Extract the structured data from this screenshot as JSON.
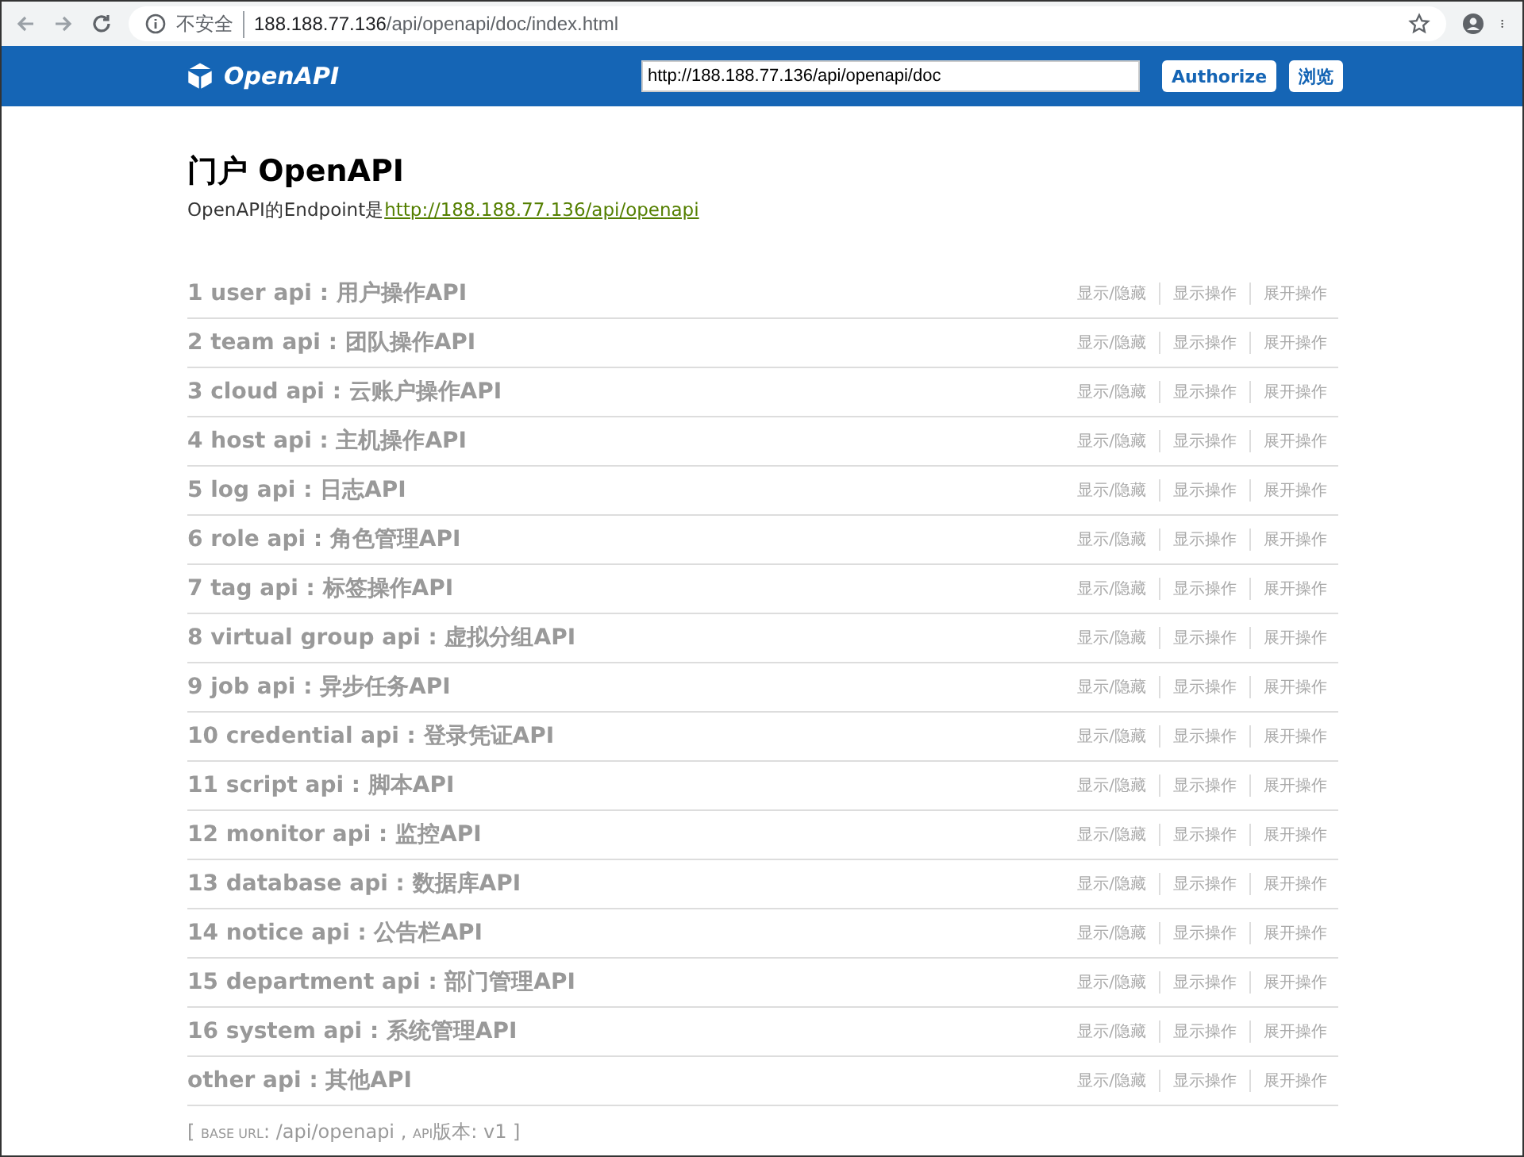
{
  "browser": {
    "security": "不安全",
    "url_host": "188.188.77.136",
    "url_path": "/api/openapi/doc/index.html"
  },
  "header": {
    "logo": "OpenAPI",
    "doc_url": "http://188.188.77.136/api/openapi/doc",
    "buttons": [
      "Authorize",
      "浏览"
    ]
  },
  "title": "门户 OpenAPI",
  "endpoint_label": "OpenAPI的Endpoint是",
  "endpoint_link": "http://188.188.77.136/api/openapi",
  "apis": [
    {
      "name": "1 user api : 用户操作API",
      "actions": [
        "显示/隐藏",
        "显示操作",
        "展开操作"
      ]
    },
    {
      "name": "2 team api : 团队操作API",
      "actions": [
        "显示/隐藏",
        "显示操作",
        "展开操作"
      ]
    },
    {
      "name": "3 cloud api : 云账户操作API",
      "actions": [
        "显示/隐藏",
        "显示操作",
        "展开操作"
      ]
    },
    {
      "name": "4 host api : 主机操作API",
      "actions": [
        "显示/隐藏",
        "显示操作",
        "展开操作"
      ]
    },
    {
      "name": "5 log api : 日志API",
      "actions": [
        "显示/隐藏",
        "显示操作",
        "展开操作"
      ]
    },
    {
      "name": "6 role api : 角色管理API",
      "actions": [
        "显示/隐藏",
        "显示操作",
        "展开操作"
      ]
    },
    {
      "name": "7 tag api : 标签操作API",
      "actions": [
        "显示/隐藏",
        "显示操作",
        "展开操作"
      ]
    },
    {
      "name": "8 virtual group api : 虚拟分组API",
      "actions": [
        "显示/隐藏",
        "显示操作",
        "展开操作"
      ]
    },
    {
      "name": "9 job api : 异步任务API",
      "actions": [
        "显示/隐藏",
        "显示操作",
        "展开操作"
      ]
    },
    {
      "name": "10 credential api : 登录凭证API",
      "actions": [
        "显示/隐藏",
        "显示操作",
        "展开操作"
      ]
    },
    {
      "name": "11 script api : 脚本API",
      "actions": [
        "显示/隐藏",
        "显示操作",
        "展开操作"
      ]
    },
    {
      "name": "12 monitor api : 监控API",
      "actions": [
        "显示/隐藏",
        "显示操作",
        "展开操作"
      ]
    },
    {
      "name": "13 database api : 数据库API",
      "actions": [
        "显示/隐藏",
        "显示操作",
        "展开操作"
      ]
    },
    {
      "name": "14 notice api : 公告栏API",
      "actions": [
        "显示/隐藏",
        "显示操作",
        "展开操作"
      ]
    },
    {
      "name": "15 department api : 部门管理API",
      "actions": [
        "显示/隐藏",
        "显示操作",
        "展开操作"
      ]
    },
    {
      "name": "16 system api : 系统管理API",
      "actions": [
        "显示/隐藏",
        "显示操作",
        "展开操作"
      ]
    },
    {
      "name": "other api : 其他API",
      "actions": [
        "显示/隐藏",
        "显示操作",
        "展开操作"
      ]
    }
  ],
  "footer": [
    {
      "text": "[ ",
      "small": false
    },
    {
      "text": "BASE URL",
      "small": true
    },
    {
      "text": ": /api/openapi , ",
      "small": false
    },
    {
      "text": "API",
      "small": true
    },
    {
      "text": "版本: v1 ]",
      "small": false
    }
  ]
}
